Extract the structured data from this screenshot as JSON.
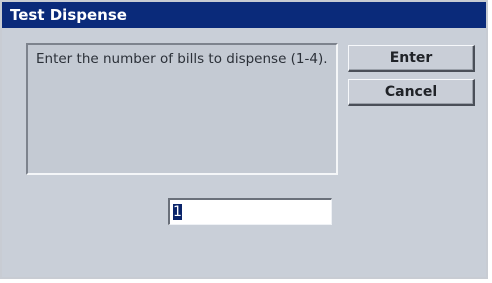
{
  "window": {
    "title": "Test Dispense"
  },
  "prompt": {
    "text": "Enter the number of bills to dispense (1-4)."
  },
  "buttons": {
    "enter_label": "Enter",
    "cancel_label": "Cancel"
  },
  "quantity_input": {
    "value": "1"
  },
  "colors": {
    "titlebar": "#0a2a7a",
    "dialog_background": "#c9cfd8",
    "selection_highlight": "#0a246a"
  }
}
